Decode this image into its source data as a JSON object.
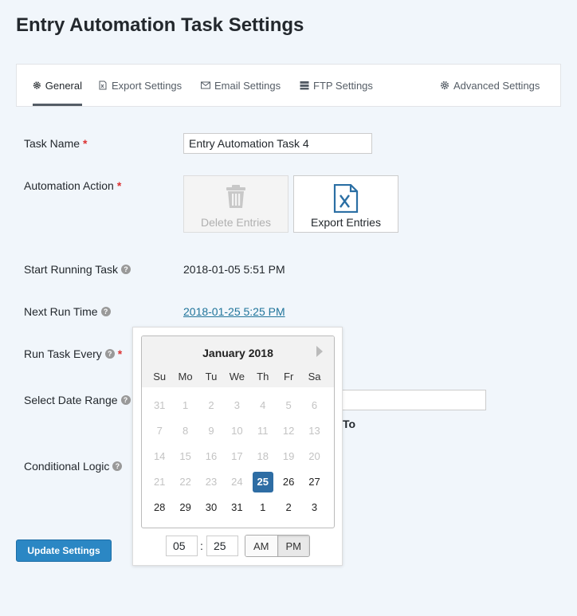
{
  "page": {
    "title": "Entry Automation Task Settings"
  },
  "tabs": [
    {
      "label": "General",
      "icon": "gear-icon",
      "active": true
    },
    {
      "label": "Export Settings",
      "icon": "file-excel-icon"
    },
    {
      "label": "Email Settings",
      "icon": "envelope-icon"
    },
    {
      "label": "FTP Settings",
      "icon": "server-icon"
    },
    {
      "label": "Advanced Settings",
      "icon": "gear-icon"
    }
  ],
  "form": {
    "task_name": {
      "label": "Task Name",
      "value": "Entry Automation Task 4"
    },
    "automation_action": {
      "label": "Automation Action",
      "delete_label": "Delete Entries",
      "export_label": "Export Entries"
    },
    "start_running": {
      "label": "Start Running Task",
      "value": "2018-01-05 5:51 PM"
    },
    "next_run": {
      "label": "Next Run Time",
      "value": "2018-01-25 5:25 PM"
    },
    "run_every": {
      "label": "Run Task Every"
    },
    "date_range": {
      "label": "Select Date Range",
      "to_label": "To"
    },
    "conditional_logic": {
      "label": "Conditional Logic"
    }
  },
  "required_mark": "*",
  "help_glyph": "?",
  "datepicker": {
    "month_label": "January 2018",
    "weekdays": [
      "Su",
      "Mo",
      "Tu",
      "We",
      "Th",
      "Fr",
      "Sa"
    ],
    "weeks": [
      [
        "31",
        "1",
        "2",
        "3",
        "4",
        "5",
        "6"
      ],
      [
        "7",
        "8",
        "9",
        "10",
        "11",
        "12",
        "13"
      ],
      [
        "14",
        "15",
        "16",
        "17",
        "18",
        "19",
        "20"
      ],
      [
        "21",
        "22",
        "23",
        "24",
        "25",
        "26",
        "27"
      ],
      [
        "28",
        "29",
        "30",
        "31",
        "1",
        "2",
        "3"
      ]
    ],
    "muted_before_selected": true,
    "selected_day": "25",
    "hour": "05",
    "minute": "25",
    "time_separator": ":",
    "am_label": "AM",
    "pm_label": "PM",
    "meridiem": "PM"
  },
  "buttons": {
    "update": "Update Settings"
  },
  "colors": {
    "primary": "#2b87c4",
    "required": "#dc3232",
    "link": "#21759b",
    "selected_day": "#2e6da4"
  }
}
